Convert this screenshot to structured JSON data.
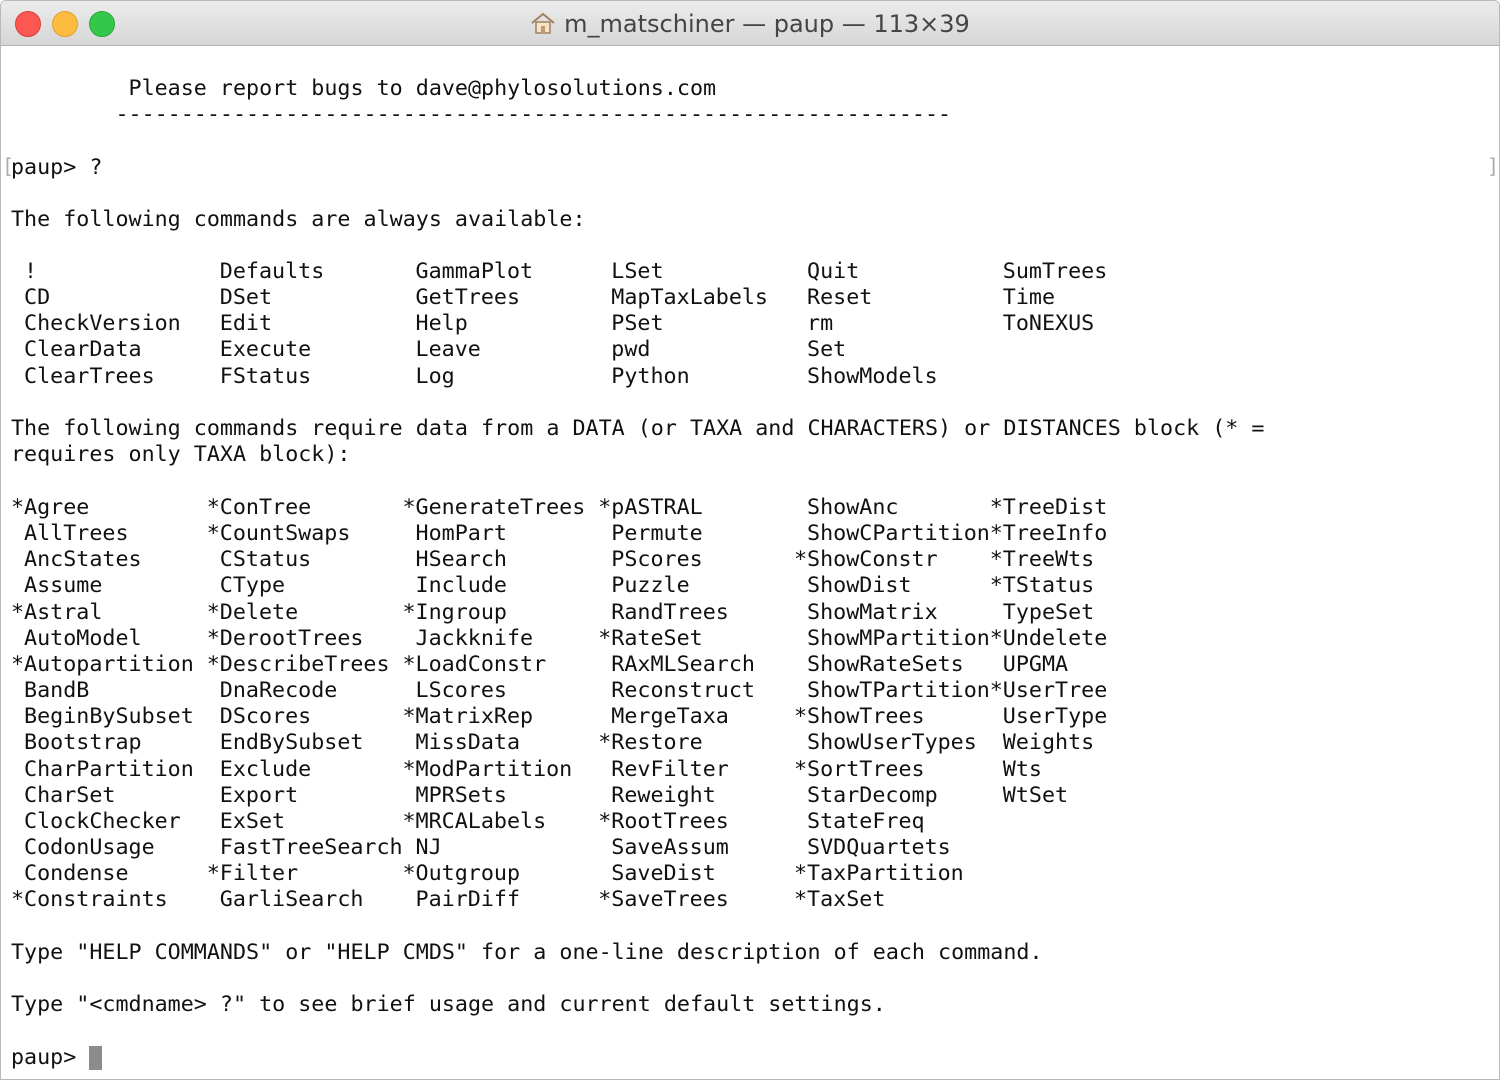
{
  "window": {
    "title": "m_matschiner — paup — 113×39",
    "icons": {
      "close": "close-button",
      "minimize": "minimize-button",
      "zoom": "zoom-button",
      "home": "home-icon"
    }
  },
  "terminal": {
    "bug_line": "         Please report bugs to dave@phylosolutions.com",
    "separator": "        ----------------------------------------------------------------",
    "prompt_line": "paup> ?",
    "always_header": "The following commands are always available:",
    "always_commands": [
      [
        " !",
        " CD",
        " CheckVersion",
        " ClearData",
        " ClearTrees"
      ],
      [
        " Defaults",
        " DSet",
        " Edit",
        " Execute",
        " FStatus"
      ],
      [
        " GammaPlot",
        " GetTrees",
        " Help",
        " Leave",
        " Log"
      ],
      [
        " LSet",
        " MapTaxLabels",
        " PSet",
        " pwd",
        " Python"
      ],
      [
        " Quit",
        " Reset",
        " rm",
        " Set",
        " ShowModels"
      ],
      [
        " SumTrees",
        " Time",
        " ToNEXUS"
      ]
    ],
    "data_header_1": "The following commands require data from a DATA (or TAXA and CHARACTERS) or DISTANCES block (* =",
    "data_header_2": "requires only TAXA block):",
    "data_commands": [
      [
        "*Agree",
        " AllTrees",
        " AncStates",
        " Assume",
        "*Astral",
        " AutoModel",
        "*Autopartition",
        " BandB",
        " BeginBySubset",
        " Bootstrap",
        " CharPartition",
        " CharSet",
        " ClockChecker",
        " CodonUsage",
        " Condense",
        "*Constraints"
      ],
      [
        "*ConTree",
        "*CountSwaps",
        " CStatus",
        " CType",
        "*Delete",
        "*DerootTrees",
        "*DescribeTrees",
        " DnaRecode",
        " DScores",
        " EndBySubset",
        " Exclude",
        " Export",
        " ExSet",
        " FastTreeSearch",
        "*Filter",
        " GarliSearch"
      ],
      [
        "*GenerateTrees",
        " HomPart",
        " HSearch",
        " Include",
        "*Ingroup",
        " Jackknife",
        "*LoadConstr",
        " LScores",
        "*MatrixRep",
        " MissData",
        "*ModPartition",
        " MPRSets",
        "*MRCALabels",
        " NJ",
        "*Outgroup",
        " PairDiff"
      ],
      [
        "*pASTRAL",
        " Permute",
        " PScores",
        " Puzzle",
        " RandTrees",
        "*RateSet",
        " RAxMLSearch",
        " Reconstruct",
        " MergeTaxa",
        "*Restore",
        " RevFilter",
        " Reweight",
        "*RootTrees",
        " SaveAssum",
        " SaveDist",
        "*SaveTrees"
      ],
      [
        " ShowAnc",
        " ShowCPartition",
        "*ShowConstr",
        " ShowDist",
        " ShowMatrix",
        " ShowMPartition",
        " ShowRateSets",
        " ShowTPartition",
        "*ShowTrees",
        " ShowUserTypes",
        "*SortTrees",
        " StarDecomp",
        " StateFreq",
        " SVDQuartets",
        "*TaxPartition",
        "*TaxSet"
      ],
      [
        "*TreeDist",
        "*TreeInfo",
        "*TreeWts",
        "*TStatus",
        " TypeSet",
        "*Undelete",
        " UPGMA",
        "*UserTree",
        " UserType",
        " Weights",
        " Wts",
        " WtSet"
      ]
    ],
    "help_line_1": "Type \"HELP COMMANDS\" or \"HELP CMDS\" for a one-line description of each command.",
    "help_line_2": "Type \"<cmdname> ?\" to see brief usage and current default settings.",
    "final_prompt": "paup> "
  }
}
